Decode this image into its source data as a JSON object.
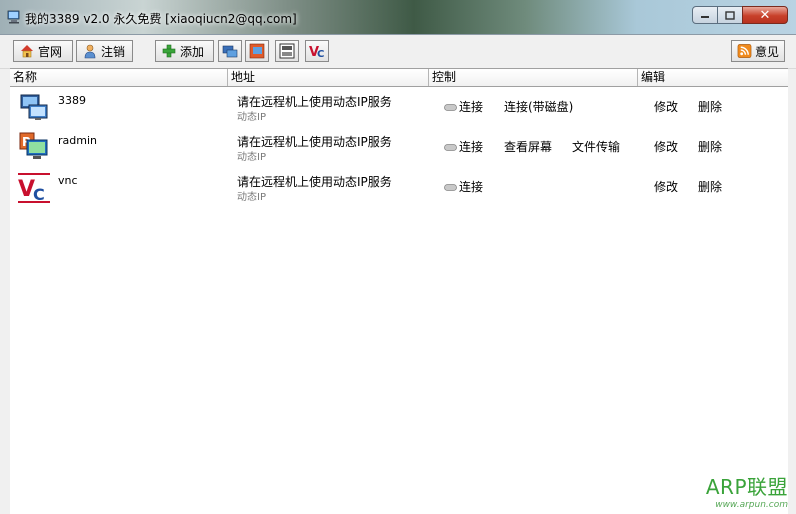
{
  "window": {
    "title": "我的3389 v2.0 永久免费 [xiaoqiucn2@qq.com]"
  },
  "toolbar": {
    "home_label": "官网",
    "logout_label": "注销",
    "add_label": "添加",
    "feedback_label": "意见"
  },
  "columns": {
    "name": "名称",
    "address": "地址",
    "control": "控制",
    "edit": "编辑"
  },
  "rows": [
    {
      "name": "3389",
      "address": "请在远程机上使用动态IP服务",
      "address_sub": "动态IP",
      "connect": "连接",
      "action2": "连接(带磁盘)",
      "action3": "",
      "modify": "修改",
      "delete": "删除"
    },
    {
      "name": "radmin",
      "address": "请在远程机上使用动态IP服务",
      "address_sub": "动态IP",
      "connect": "连接",
      "action2": "查看屏幕",
      "action3": "文件传输",
      "modify": "修改",
      "delete": "删除"
    },
    {
      "name": "vnc",
      "address": "请在远程机上使用动态IP服务",
      "address_sub": "动态IP",
      "connect": "连接",
      "action2": "",
      "action3": "",
      "modify": "修改",
      "delete": "删除"
    }
  ],
  "watermark": {
    "brand": "ARP联盟",
    "url": "www.arpun.com"
  },
  "icons": {
    "app": "computer-icon",
    "home": "home-icon",
    "logout": "user-icon",
    "add": "plus-icon",
    "mstsc": "remote-desktop-icon",
    "radmin": "radmin-icon",
    "vnc_viewer": "vnc-viewer-icon",
    "vnc": "vnc-icon",
    "feedback": "rss-icon"
  },
  "colors": {
    "accent_add": "#3aa53a",
    "feedback_orange": "#f08a1c",
    "vnc_red": "#c8102e",
    "vnc_blue": "#1f4fa0",
    "watermark_green": "#3aa33a"
  }
}
